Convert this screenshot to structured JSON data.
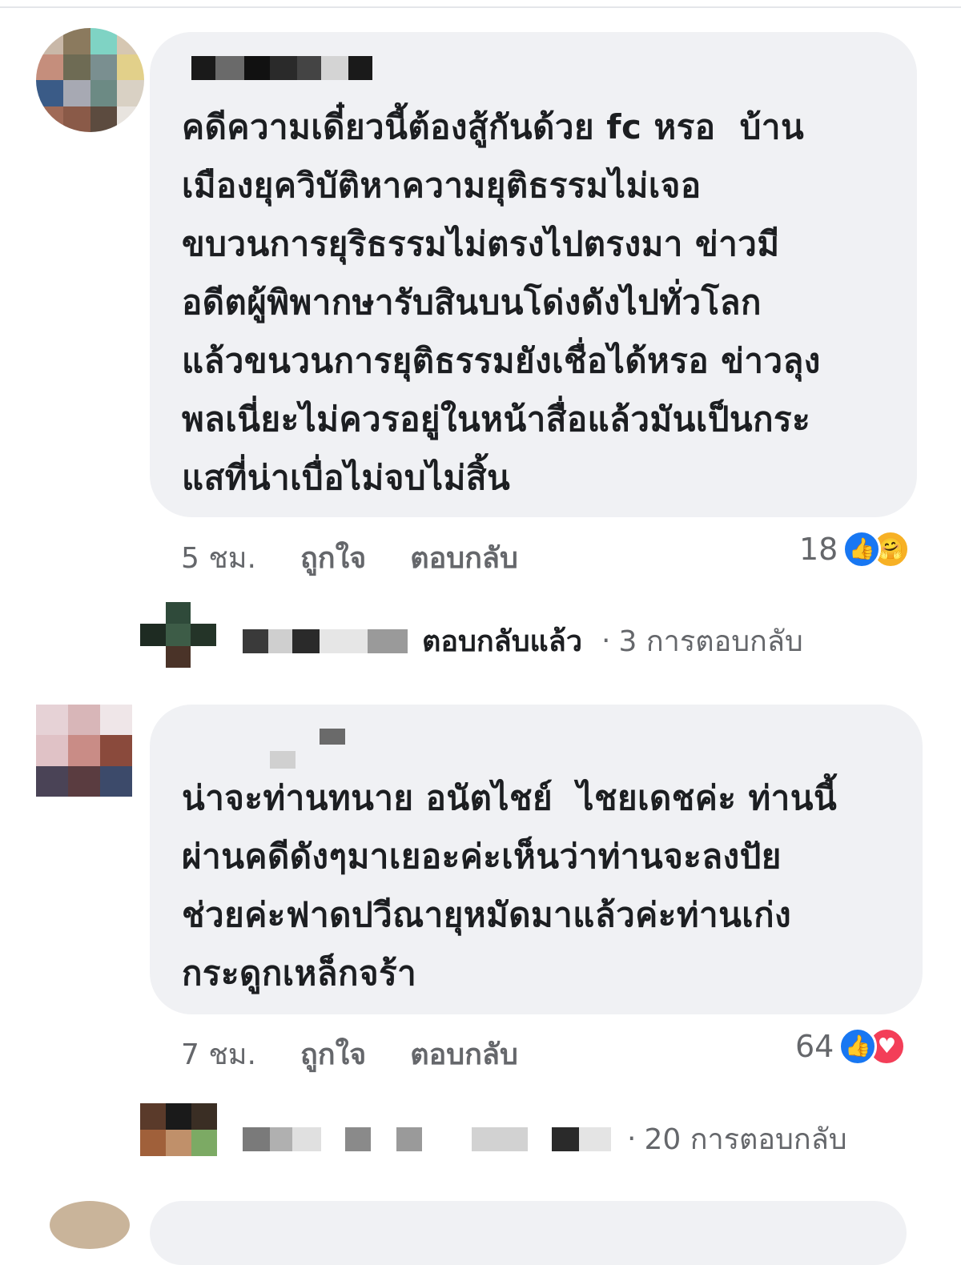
{
  "comments": [
    {
      "text": "คดีความเดี๋ยวนี้ต้องสู้กันด้วย fc หรอ  บ้าน\nเมืองยุควิบัติหาความยุติธรรมไม่เจอ\nขบวนการยุริธรรมไม่ตรงไปตรงมา ข่าวมี\nอดีตผู้พิพากษารับสินบนโด่งดังไปทั่วโลก\nแล้วขนวนการยุติธรรมยังเชื่อได้หรอ ข่าวลุง\nพลเนี่ยะไม่ควรอยู่ในหน้าสื่อแล้วมันเป็นกระ\nแสที่น่าเบื่อไม่จบไม่สิ้น",
      "time": "5 ชม.",
      "like_label": "ถูกใจ",
      "reply_label": "ตอบกลับ",
      "reaction_count": "18",
      "reactions": [
        "like-icon",
        "care-icon"
      ],
      "replied_text": "ตอบกลับแล้ว",
      "replies_count": "3 การตอบกลับ"
    },
    {
      "text": "น่าจะท่านทนาย อนัตไชย์  ไชยเดชค่ะ ท่านนี้\nผ่านคดีดังๆมาเยอะค่ะเห็นว่าท่านจะลงปัย\nช่วยค่ะฟาดปวีณายุหมัดมาแล้วค่ะท่านเก่ง\nกระดูกเหล็กจร้า",
      "time": "7 ชม.",
      "like_label": "ถูกใจ",
      "reply_label": "ตอบกลับ",
      "reaction_count": "64",
      "reactions": [
        "like-icon",
        "love-icon"
      ],
      "replies_count": "20 การตอบกลับ"
    }
  ],
  "colors": {
    "bubble": "#f0f1f4",
    "secondary_text": "#65676b",
    "like_blue": "#1877f2",
    "love_red": "#f33e58",
    "care_yellow": "#f7b125"
  }
}
